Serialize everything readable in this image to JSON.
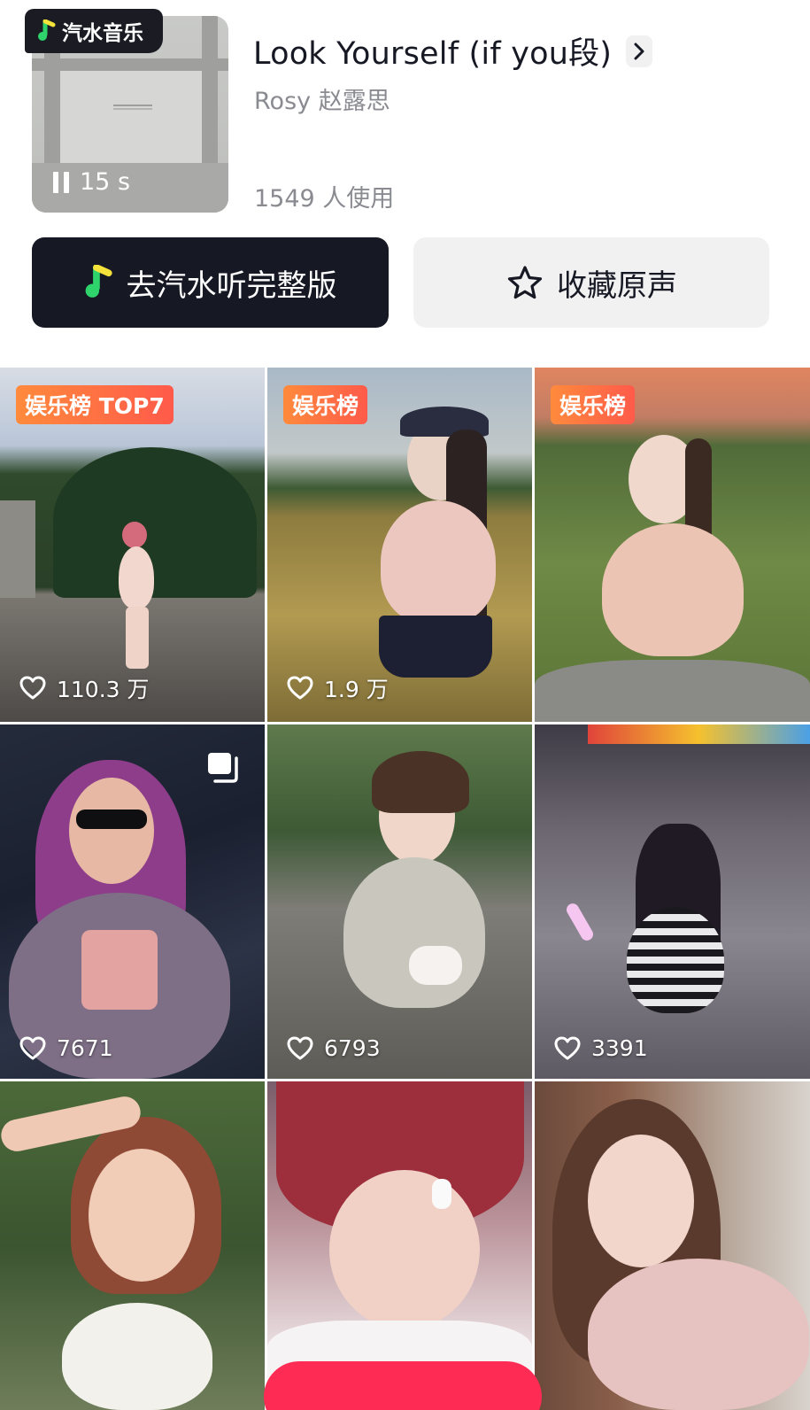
{
  "music": {
    "platform_badge": "汽水音乐",
    "title": "Look Yourself (if you段)",
    "artist": "Rosy 赵露思",
    "duration": "15 s",
    "usage": "1549 人使用",
    "playing_state": "paused"
  },
  "actions": {
    "listen_full": "去汽水听完整版",
    "favorite": "收藏原声"
  },
  "colors": {
    "dark": "#161823",
    "accent_pink": "#fe2c55",
    "tag_orange": "#ff6b45",
    "qishui_green": "#2fd36c",
    "qishui_yellow": "#f5e23a"
  },
  "videos": [
    {
      "tag": "娱乐榜 TOP7",
      "likes": "110.3 万",
      "multi": false
    },
    {
      "tag": "娱乐榜",
      "likes": "1.9 万",
      "multi": false
    },
    {
      "tag": "娱乐榜",
      "likes": "",
      "multi": false
    },
    {
      "tag": "",
      "likes": "7671",
      "multi": true
    },
    {
      "tag": "",
      "likes": "6793",
      "multi": false
    },
    {
      "tag": "",
      "likes": "3391",
      "multi": false
    },
    {
      "tag": "",
      "likes": "",
      "multi": false
    },
    {
      "tag": "",
      "likes": "",
      "multi": false
    },
    {
      "tag": "",
      "likes": "",
      "multi": false
    }
  ]
}
